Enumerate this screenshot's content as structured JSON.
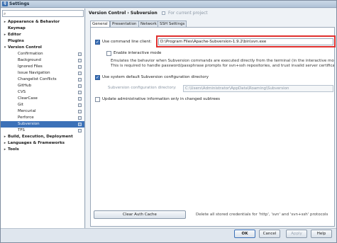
{
  "window": {
    "title": "Settings",
    "app_icon": "IJ"
  },
  "sidebar": {
    "search_icon": "search-icon",
    "items": [
      {
        "label": "Appearance & Behavior",
        "level": 0,
        "arrow": "▸"
      },
      {
        "label": "Keymap",
        "level": 0,
        "arrow": ""
      },
      {
        "label": "Editor",
        "level": 0,
        "arrow": "▸"
      },
      {
        "label": "Plugins",
        "level": 0,
        "arrow": ""
      },
      {
        "label": "Version Control",
        "level": 0,
        "arrow": "▾"
      },
      {
        "label": "Confirmation",
        "level": 1,
        "proj": true
      },
      {
        "label": "Background",
        "level": 1,
        "proj": true
      },
      {
        "label": "Ignored Files",
        "level": 1,
        "proj": true
      },
      {
        "label": "Issue Navigation",
        "level": 1,
        "proj": true
      },
      {
        "label": "Changelist Conflicts",
        "level": 1,
        "proj": true
      },
      {
        "label": "GitHub",
        "level": 1,
        "proj": true
      },
      {
        "label": "CVS",
        "level": 1,
        "proj": true
      },
      {
        "label": "ClearCase",
        "level": 1,
        "proj": true
      },
      {
        "label": "Git",
        "level": 1,
        "proj": true
      },
      {
        "label": "Mercurial",
        "level": 1,
        "proj": true
      },
      {
        "label": "Perforce",
        "level": 1,
        "proj": true
      },
      {
        "label": "Subversion",
        "level": 1,
        "proj": true,
        "selected": true
      },
      {
        "label": "TFS",
        "level": 1,
        "proj": true
      },
      {
        "label": "Build, Execution, Deployment",
        "level": 0,
        "arrow": "▸"
      },
      {
        "label": "Languages & Frameworks",
        "level": 0,
        "arrow": "▸"
      },
      {
        "label": "Tools",
        "level": 0,
        "arrow": "▸"
      }
    ]
  },
  "content": {
    "breadcrumb": "Version Control › Subversion",
    "project_note": "For current project",
    "tabs": [
      "General",
      "Presentation",
      "Network",
      "SSH Settings"
    ],
    "active_tab": "General",
    "use_cmd_client": {
      "label": "Use command line client:",
      "checked": true
    },
    "cmd_path": "D:\\Program Files\\Apache-Subversion-1.9.2\\bin\\svn.exe",
    "interactive_mode": {
      "label": "Enable interactive mode",
      "checked": false
    },
    "description": [
      "Emulates the behavior when Subversion commands are executed directly from the terminal (in the interactive mode).",
      "This is required to handle password/passphrase prompts for svn+ssh repositories, and trust invalid server certificates."
    ],
    "use_default_config": {
      "label": "Use system default Subversion configuration directory",
      "checked": true
    },
    "config_dir_label": "Subversion configuration directory:",
    "config_dir_value": "C:\\Users\\Administrator\\AppData\\Roaming\\Subversion",
    "update_admin": {
      "label": "Update administrative information only in changed subtrees",
      "checked": false
    },
    "clear_auth_button": "Clear Auth Cache",
    "clear_auth_desc": "Delete all stored credentials for 'http', 'svn' and 'svn+ssh' protocols"
  },
  "footer": {
    "ok": "OK",
    "cancel": "Cancel",
    "apply": "Apply",
    "help": "Help"
  },
  "colors": {
    "accent": "#3c71b8",
    "highlight": "#e0302e"
  }
}
